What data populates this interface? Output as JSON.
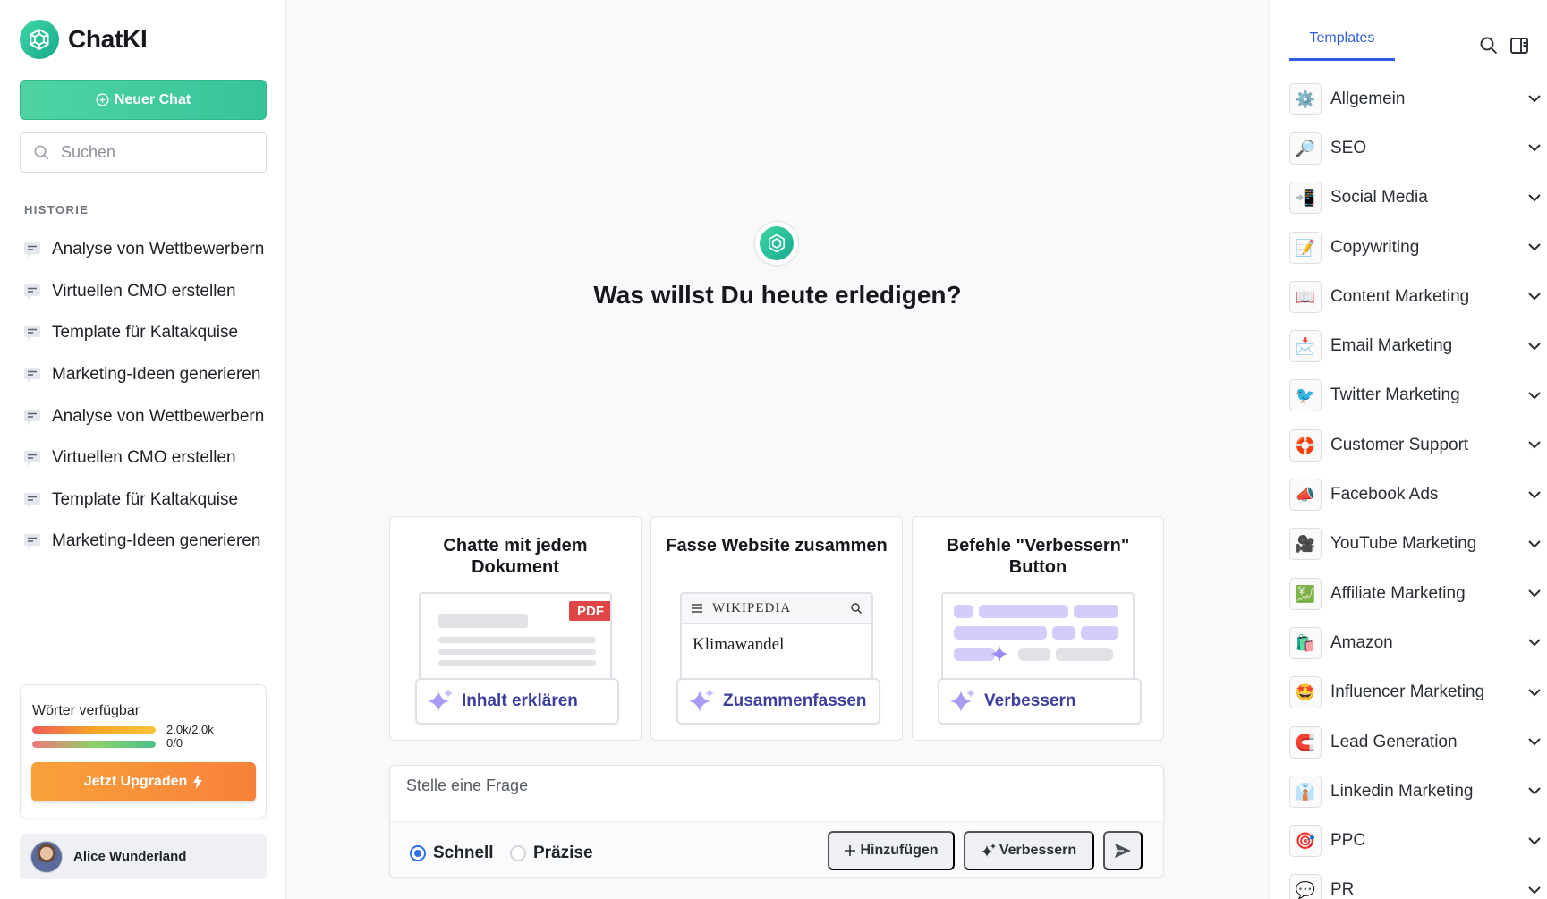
{
  "app": {
    "name": "ChatKI"
  },
  "sidebar": {
    "new_chat_label": "Neuer Chat",
    "search_placeholder": "Suchen",
    "history_title": "HISTORIE",
    "history": [
      "Analyse von Wettbewerbern",
      "Virtuellen CMO erstellen",
      "Template für Kaltakquise",
      "Marketing-Ideen generieren",
      "Analyse von Wettbewerbern",
      "Virtuellen CMO erstellen",
      "Template für Kaltakquise",
      "Marketing-Ideen generieren"
    ],
    "words": {
      "label": "Wörter verfügbar",
      "count1": "2.0k/2.0k",
      "fill1": 1.0,
      "count2": "0/0",
      "fill2": 1.0,
      "upgrade_label": "Jetzt Upgraden"
    },
    "user": {
      "name": "Alice Wunderland"
    }
  },
  "main": {
    "headline": "Was willst Du heute erledigen?",
    "cards": [
      {
        "title": "Chatte mit jedem Dokument",
        "badge": "PDF",
        "action": "Inhalt erklären"
      },
      {
        "title": "Fasse Website zusammen",
        "site": "WIKIPEDIA",
        "article": "Klimawandel",
        "action": "Zusammenfassen"
      },
      {
        "title": "Befehle \"Verbessern\" Button",
        "action": "Verbessern"
      }
    ],
    "composer": {
      "placeholder": "Stelle eine Frage",
      "mode_fast": "Schnell",
      "mode_precise": "Präzise",
      "selected_mode": "Schnell",
      "add_label": "Hinzufügen",
      "improve_label": "Verbessern"
    }
  },
  "right": {
    "tab_label": "Templates",
    "templates": [
      {
        "label": "Allgemein",
        "icon": "⚙️"
      },
      {
        "label": "SEO",
        "icon": "🔎"
      },
      {
        "label": "Social Media",
        "icon": "📲"
      },
      {
        "label": "Copywriting",
        "icon": "📝"
      },
      {
        "label": "Content Marketing",
        "icon": "📖"
      },
      {
        "label": "Email Marketing",
        "icon": "📩"
      },
      {
        "label": "Twitter Marketing",
        "icon": "🐦"
      },
      {
        "label": "Customer Support",
        "icon": "🛟"
      },
      {
        "label": "Facebook Ads",
        "icon": "📣"
      },
      {
        "label": "YouTube Marketing",
        "icon": "🎥"
      },
      {
        "label": "Affiliate Marketing",
        "icon": "💹"
      },
      {
        "label": "Amazon",
        "icon": "🛍️"
      },
      {
        "label": "Influencer Marketing",
        "icon": "🤩"
      },
      {
        "label": "Lead Generation",
        "icon": "🧲"
      },
      {
        "label": "Linkedin Marketing",
        "icon": "👔"
      },
      {
        "label": "PPC",
        "icon": "🎯"
      },
      {
        "label": "PR",
        "icon": "💬"
      }
    ]
  },
  "colors": {
    "accent_green": "#37c49a",
    "link_blue": "#2f5fe0",
    "upgrade_orange": "#f7803a",
    "action_purple": "#3d3f9e"
  }
}
